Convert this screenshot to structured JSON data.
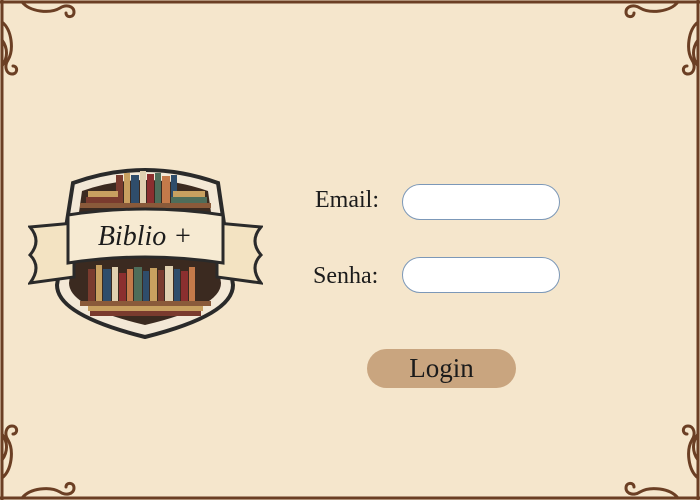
{
  "logo": {
    "text": "Biblio +"
  },
  "form": {
    "email_label": "Email:",
    "email_value": "",
    "password_label": "Senha:",
    "password_value": "",
    "login_label": "Login"
  },
  "colors": {
    "background": "#f5e6cc",
    "border": "#6b3f24",
    "button": "#c9a57f",
    "input_border": "#7c98b8"
  }
}
